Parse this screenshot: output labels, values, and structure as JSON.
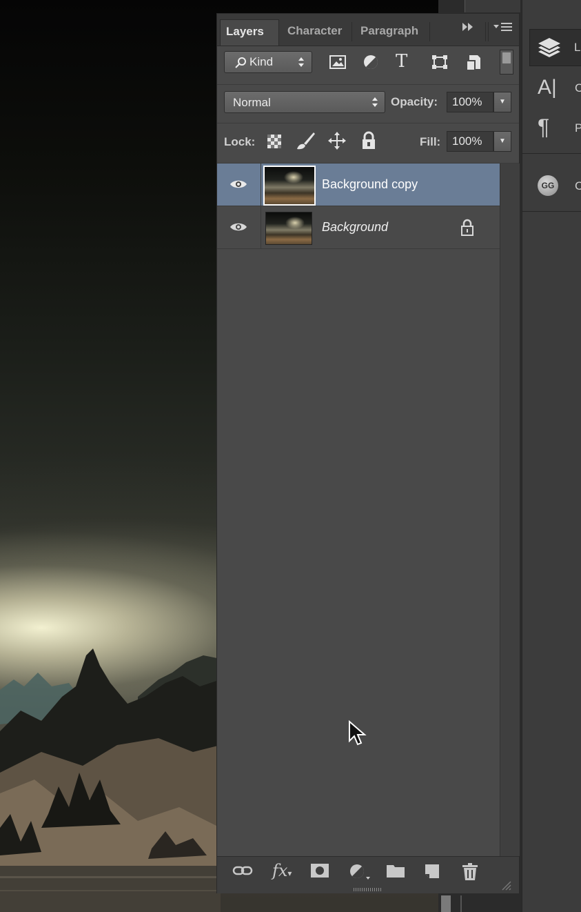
{
  "layers_panel": {
    "tabs": [
      {
        "label": "Layers",
        "active": true
      },
      {
        "label": "Character",
        "active": false
      },
      {
        "label": "Paragraph",
        "active": false
      }
    ],
    "overflow_icon": "double-chevron-right",
    "panel_menu_icon": "panel-menu",
    "filter": {
      "kind_label": "Kind",
      "filter_icons": [
        "pixel-filter-icon",
        "adjustment-filter-icon",
        "type-filter-icon",
        "shape-filter-icon",
        "smart-object-filter-icon"
      ]
    },
    "blend_mode": "Normal",
    "opacity_label": "Opacity:",
    "opacity_value": "100%",
    "lock_label": "Lock:",
    "lock_icons": [
      "lock-transparent-icon",
      "lock-image-icon",
      "lock-position-icon",
      "lock-all-icon"
    ],
    "fill_label": "Fill:",
    "fill_value": "100%",
    "layers": [
      {
        "name": "Background copy",
        "visible": true,
        "selected": true,
        "locked": false
      },
      {
        "name": "Background",
        "visible": true,
        "selected": false,
        "locked": true
      }
    ],
    "bottom_icons": [
      "link-icon",
      "fx-icon",
      "mask-icon",
      "adjustment-icon",
      "folder-icon",
      "new-layer-icon",
      "trash-icon"
    ],
    "bottom_fx_label": "fx"
  },
  "dock": {
    "items": [
      {
        "icon": "layers-icon",
        "label": "L"
      },
      {
        "icon": "character-icon",
        "label": "C"
      },
      {
        "icon": "paragraph-icon",
        "label": "P"
      },
      {
        "icon": "glyphs-icon",
        "label": "C"
      }
    ],
    "character_glyph": "A|",
    "paragraph_glyph": "¶",
    "glyphs_badge": "GG"
  },
  "colors": {
    "panel_bg": "#494949",
    "selected_row": "#6a7d96",
    "tabbar_bg": "#3a3a3a"
  }
}
